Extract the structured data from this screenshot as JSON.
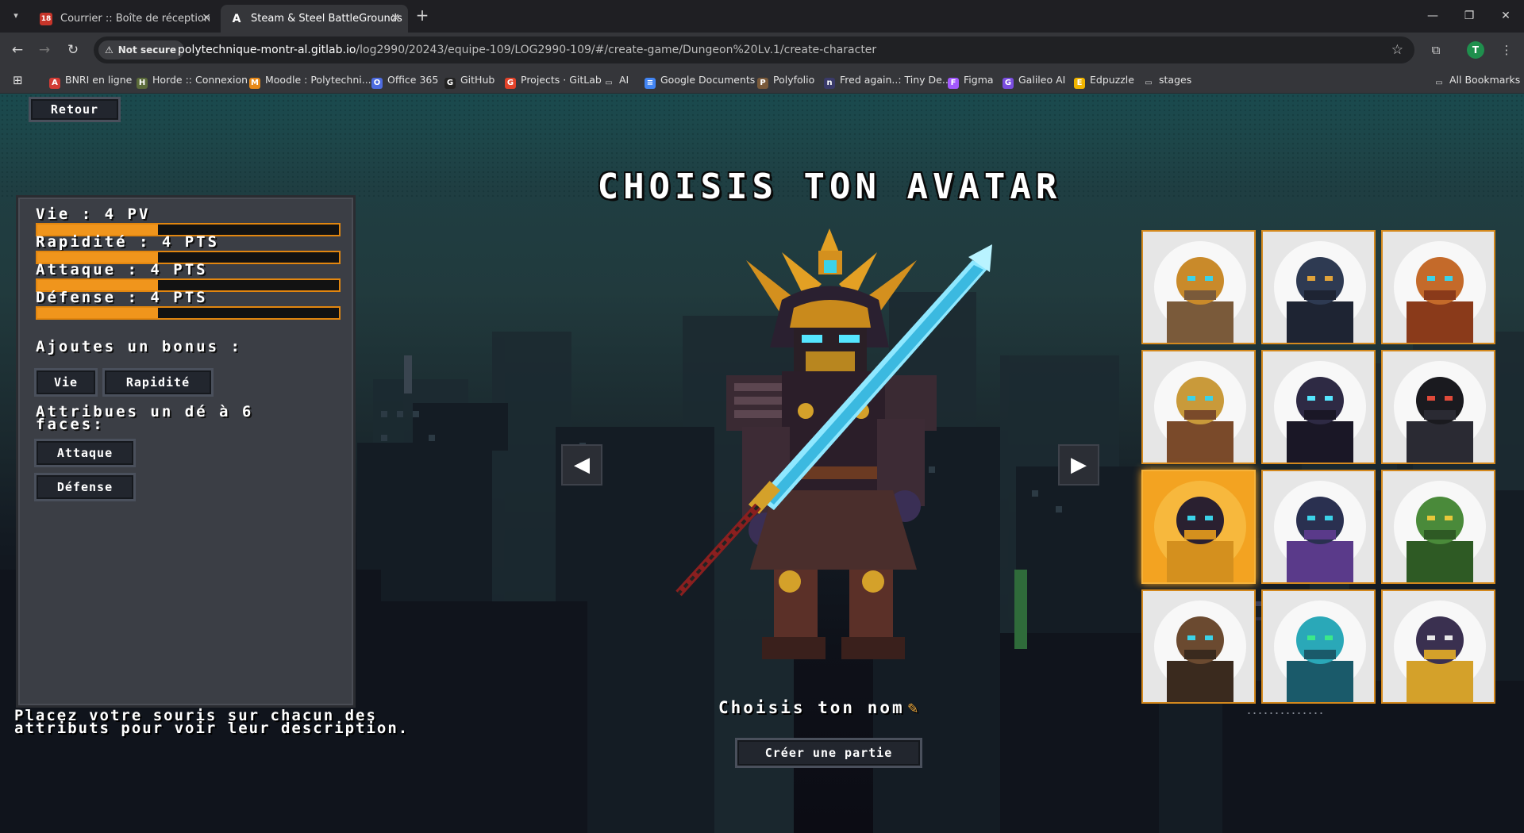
{
  "browser": {
    "tabs": [
      {
        "title": "Courrier :: Boîte de réception",
        "icon": "mail-icon",
        "badge": "18",
        "active": false
      },
      {
        "title": "Steam & Steel BattleGrounds",
        "icon": "angular-icon",
        "badge": "A",
        "active": true
      }
    ],
    "address": {
      "security_label": "Not secure",
      "host": "polytechnique-montr-al.gitlab.io",
      "path": "/log2990/20243/equipe-109/LOG2990-109/#/create-game/Dungeon%20Lv.1/create-character"
    },
    "profile_initial": "T",
    "bookmarks": [
      {
        "label": "BNRI en ligne",
        "icon": "bnri-icon",
        "color": "#d23b34",
        "glyph": "A"
      },
      {
        "label": "Horde :: Connexion",
        "icon": "horde-icon",
        "color": "#5b6b3a",
        "glyph": "H"
      },
      {
        "label": "Moodle : Polytechni...",
        "icon": "moodle-icon",
        "color": "#e88a1a",
        "glyph": "M"
      },
      {
        "label": "Office 365",
        "icon": "office-icon",
        "color": "#4d6be0",
        "glyph": "O"
      },
      {
        "label": "GitHub",
        "icon": "github-icon",
        "color": "#222222",
        "glyph": "G"
      },
      {
        "label": "Projects · GitLab",
        "icon": "gitlab-icon",
        "color": "#e2432a",
        "glyph": "G"
      },
      {
        "label": "AI",
        "icon": "folder-icon",
        "color": "transparent",
        "glyph": "▭"
      },
      {
        "label": "Google Documents",
        "icon": "docs-icon",
        "color": "#4285f4",
        "glyph": "≡"
      },
      {
        "label": "Polyfolio",
        "icon": "polyfolio-icon",
        "color": "#7a5a3a",
        "glyph": "P"
      },
      {
        "label": "Fred again..: Tiny De...",
        "icon": "npr-icon",
        "color": "#3a3a6a",
        "glyph": "n"
      },
      {
        "label": "Figma",
        "icon": "figma-icon",
        "color": "#a259ff",
        "glyph": "F"
      },
      {
        "label": "Galileo AI",
        "icon": "galileo-icon",
        "color": "#7a4de0",
        "glyph": "G"
      },
      {
        "label": "Edpuzzle",
        "icon": "edpuzzle-icon",
        "color": "#f0b400",
        "glyph": "E"
      },
      {
        "label": "stages",
        "icon": "folder-icon",
        "color": "transparent",
        "glyph": "▭"
      }
    ],
    "all_bookmarks": "All Bookmarks"
  },
  "game": {
    "back_label": "Retour",
    "title": "CHOISIS TON AVATAR",
    "stats": [
      {
        "label": "Vie : 4 PV",
        "value": 4,
        "max": 10
      },
      {
        "label": "Rapidité : 4 PTS",
        "value": 4,
        "max": 10
      },
      {
        "label": "Attaque : 4 PTS",
        "value": 4,
        "max": 10
      },
      {
        "label": "Défense : 4 PTS",
        "value": 4,
        "max": 10
      }
    ],
    "bonus_label": "Ajoutes un bonus :",
    "bonus_buttons": [
      "Vie",
      "Rapidité"
    ],
    "dice_label": "Attribues un dé à 6 faces:",
    "dice_buttons": [
      "Attaque",
      "Défense"
    ],
    "hint_line1": "Placez votre souris sur chacun des",
    "hint_line2": "attributs pour voir leur description.",
    "name_label": "Choisis ton nom",
    "create_label": "Créer une partie",
    "avatars": [
      {
        "name": "avatar-hammer-robot",
        "selected": false
      },
      {
        "name": "avatar-goggle-gunner",
        "selected": false
      },
      {
        "name": "avatar-spider-bot",
        "selected": false
      },
      {
        "name": "avatar-blonde-engineer",
        "selected": false
      },
      {
        "name": "avatar-tophat-wizard",
        "selected": false
      },
      {
        "name": "avatar-hooded-rogue",
        "selected": false
      },
      {
        "name": "avatar-samurai",
        "selected": true
      },
      {
        "name": "avatar-witch",
        "selected": false
      },
      {
        "name": "avatar-green-orc",
        "selected": false
      },
      {
        "name": "avatar-bearded-mechanic",
        "selected": false
      },
      {
        "name": "avatar-hooded-specter",
        "selected": false
      },
      {
        "name": "avatar-old-king",
        "selected": false
      }
    ]
  },
  "colors": {
    "accent": "#f0951c",
    "panel": "#3b3e45",
    "selected_avatar": "#f3a321"
  }
}
